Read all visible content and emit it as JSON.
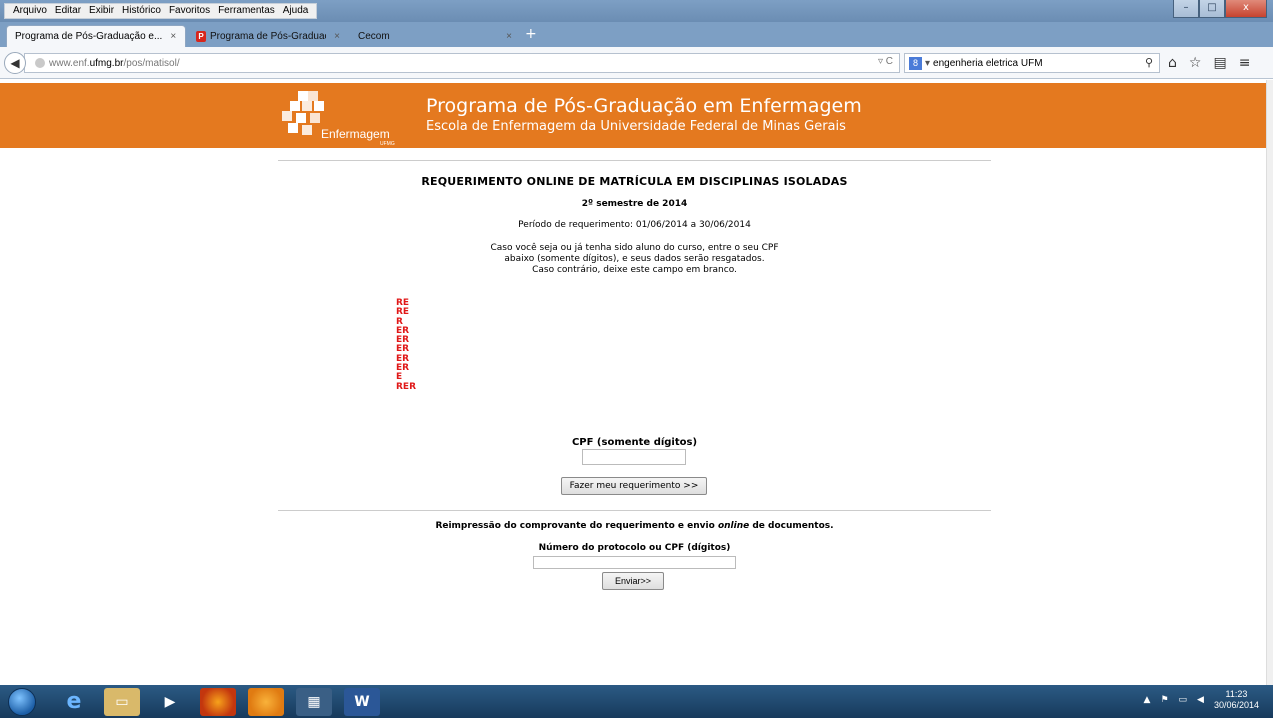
{
  "menu": [
    "Arquivo",
    "Editar",
    "Exibir",
    "Histórico",
    "Favoritos",
    "Ferramentas",
    "Ajuda"
  ],
  "window_buttons": {
    "minimize": "–",
    "maximize": "□",
    "close": "x"
  },
  "tabs": [
    {
      "label": "Programa de Pós-Graduação e...",
      "close": "×",
      "active": true
    },
    {
      "label": "Programa de Pós-Graduaç...",
      "close": "×",
      "active": false
    },
    {
      "label": "Cecom",
      "close": "×",
      "active": false
    }
  ],
  "new_tab": "+",
  "url": {
    "prefix": "www.enf.",
    "domain": "ufmg.br",
    "path": "/pos/matisol/"
  },
  "search": {
    "engine": "8",
    "value": "engenheria eletrica UFM"
  },
  "header": {
    "logo_text": "Enfermagem",
    "logo_sub": "UFMG",
    "title": "Programa de Pós-Graduação em Enfermagem",
    "subtitle": "Escola de Enfermagem da Universidade Federal de Minas Gerais"
  },
  "content": {
    "main_title": "REQUERIMENTO ONLINE DE MATRÍCULA EM DISCIPLINAS ISOLADAS",
    "semester": "2º semestre de 2014",
    "period": "Período de requerimento: 01/06/2014 a 30/06/2014",
    "instructions": [
      "Caso você seja ou já tenha sido aluno do curso, entre o seu CPF",
      "abaixo (somente dígitos), e seus dados serão resgatados.",
      "Caso contrário, deixe este campo em branco."
    ],
    "red_codes": [
      "RE",
      "RE",
      "R",
      "ER",
      "ER",
      "ER",
      "ER",
      "ER",
      "E",
      "RER"
    ],
    "cpf_label": "CPF (somente dígitos)",
    "cpf_value": "",
    "submit_label": "Fazer meu requerimento >>",
    "reprint_before": "Reimpressão do comprovante do requerimento e envio ",
    "reprint_italic": "online",
    "reprint_after": " de documentos.",
    "protocol_label": "Número do protocolo ou CPF (dígitos)",
    "protocol_value": "",
    "enviar_label": "Enviar>>"
  },
  "taskbar": {
    "clock_time": "11:23",
    "clock_date": "30/06/2014"
  }
}
